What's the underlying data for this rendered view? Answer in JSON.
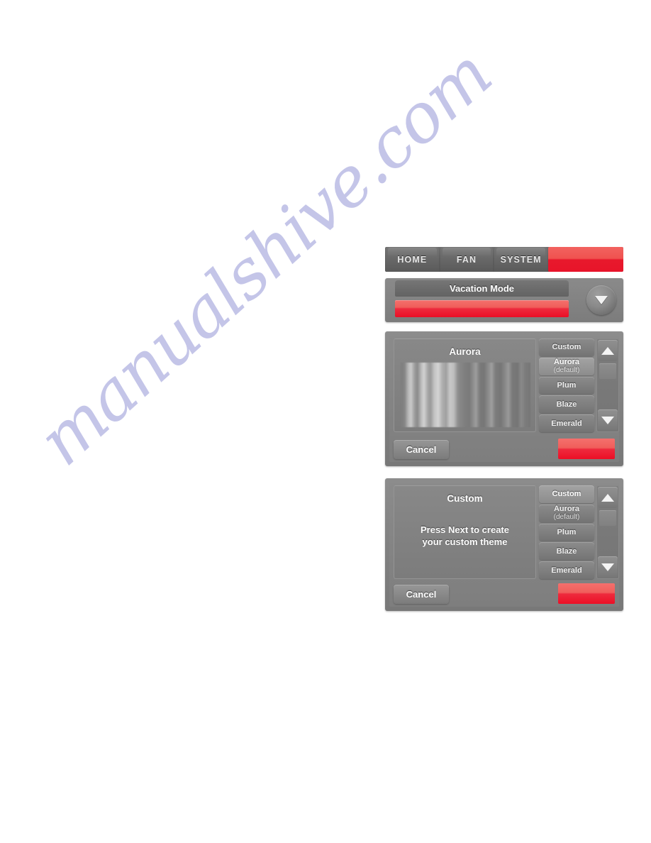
{
  "watermark": {
    "text": "manualshive.com"
  },
  "navbar": {
    "tabs": [
      {
        "label": "HOME"
      },
      {
        "label": "FAN"
      },
      {
        "label": "SYSTEM"
      }
    ],
    "action_label": ""
  },
  "vacation_panel": {
    "title": "Vacation Mode",
    "bar_label": "",
    "circle_icon": "chevron-down-icon"
  },
  "theme_screens": [
    {
      "preview_title": "Aurora",
      "preview_message": "",
      "has_stripes": true,
      "selected_theme": "Aurora",
      "options": [
        {
          "label": "Custom",
          "sub": ""
        },
        {
          "label": "Aurora",
          "sub": "(default)"
        },
        {
          "label": "Plum",
          "sub": ""
        },
        {
          "label": "Blaze",
          "sub": ""
        },
        {
          "label": "Emerald",
          "sub": ""
        }
      ],
      "cancel_label": "Cancel",
      "next_label": "",
      "scroll_up_icon": "triangle-up-icon",
      "scroll_down_icon": "triangle-down-icon"
    },
    {
      "preview_title": "Custom",
      "preview_message": "Press Next to create\nyour custom theme",
      "has_stripes": false,
      "selected_theme": "Custom",
      "options": [
        {
          "label": "Custom",
          "sub": ""
        },
        {
          "label": "Aurora",
          "sub": "(default)"
        },
        {
          "label": "Plum",
          "sub": ""
        },
        {
          "label": "Blaze",
          "sub": ""
        },
        {
          "label": "Emerald",
          "sub": ""
        }
      ],
      "cancel_label": "Cancel",
      "next_label": "",
      "scroll_up_icon": "triangle-up-icon",
      "scroll_down_icon": "triangle-down-icon"
    }
  ],
  "colors": {
    "accent_red_light": "#f4706d",
    "accent_red_dark": "#ea0f26",
    "chrome_gray": "#828282",
    "screen_gray": "#7e7e7e",
    "watermark_blue": "#aeb0e0"
  }
}
